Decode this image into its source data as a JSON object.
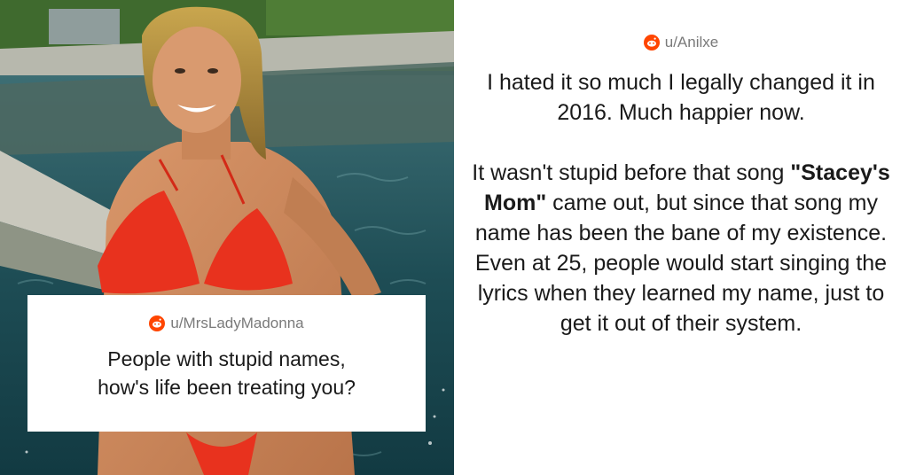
{
  "photo": {
    "description_icon": "photo"
  },
  "post": {
    "username": "u/MrsLadyMadonna",
    "title_line1": "People with stupid names,",
    "title_line2": "how's life been treating you?"
  },
  "comment": {
    "username": "u/Anilxe",
    "paragraph1": "I hated it so much I legally changed it in 2016. Much happier now.",
    "paragraph2_before": "It wasn't stupid before that song ",
    "paragraph2_bold": "\"Stacey's Mom\"",
    "paragraph2_after": " came out, but since that song my name has been the bane of my existence. Even at 25, people would start singing the lyrics when they learned my name, just to get it out of their system."
  },
  "colors": {
    "reddit_orange": "#ff4500",
    "muted_text": "#7a7a7a",
    "body_text": "#1a1a1a"
  }
}
